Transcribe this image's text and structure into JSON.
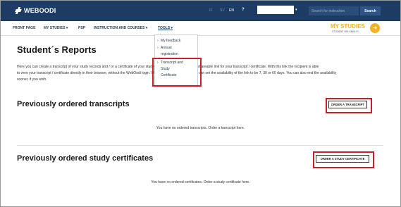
{
  "header": {
    "logo_text": "WEBOODI",
    "languages": [
      "FI",
      "SV",
      "EN"
    ],
    "active_language": "EN",
    "help_label": "?",
    "search_placeholder": "Search for instruction",
    "search_button": "Search"
  },
  "nav": {
    "items": [
      "FRONT PAGE",
      "MY STUDIES",
      "PSP",
      "INSTRUCTION AND COURSES",
      "TOOLS"
    ],
    "my_studies_title": "MY STUDIES",
    "my_studies_sub": "STUDENT HELSINKI.FI"
  },
  "tools_menu": {
    "items": [
      "My feedback",
      "Annual",
      "registration",
      "Transcript and",
      "Study",
      "Certificate"
    ]
  },
  "page": {
    "title": "Student´s Reports",
    "intro_line1": "Here you can create a transcript of your study records and / or a certificate of your studies. You can also generate a shareable link for your transcript / certificate. With this link the recipient is able",
    "intro_line2": "to view your transcript / certificate directly in their browser, without the WebOodi login. When generating the link, you can set the availability of the link to be 7, 30 or 60 days. You can also end the availability",
    "intro_line3": "sooner, if you wish."
  },
  "transcripts": {
    "title": "Previously ordered transcripts",
    "button": "ORDER A TRANSCRIPT",
    "empty": "You have no ordered transcripts. Order a transcript here."
  },
  "certificates": {
    "title": "Previously ordered study certificates",
    "button": "ORDER A STUDY CERTIFICATE",
    "empty": "You have no ordered certificates. Order a study certificate here."
  },
  "colors": {
    "header_bg": "#1c3c63",
    "accent": "#f0b323",
    "highlight": "#c8202a"
  }
}
